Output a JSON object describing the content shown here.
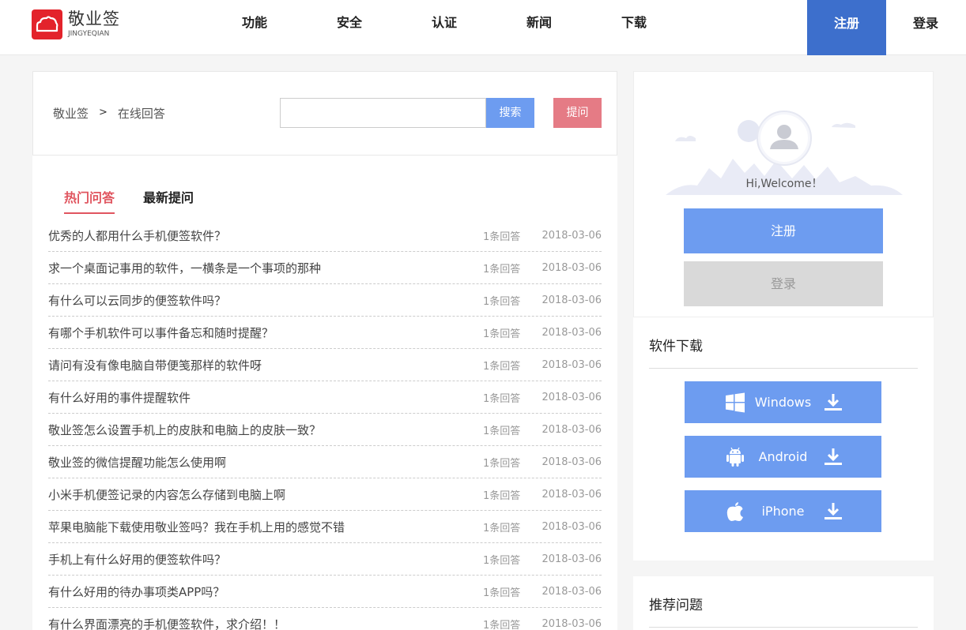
{
  "header": {
    "logo_cn": "敬业签",
    "logo_en": "JINGYEQIAN",
    "nav": [
      "功能",
      "安全",
      "认证",
      "新闻",
      "下载"
    ],
    "register": "注册",
    "login": "登录"
  },
  "search": {
    "breadcrumb_home": "敬业签",
    "breadcrumb_sep": ">",
    "breadcrumb_current": "在线回答",
    "input_value": "",
    "search_btn": "搜索",
    "ask_btn": "提问"
  },
  "tabs": [
    {
      "label": "热门问答",
      "active": true
    },
    {
      "label": "最新提问",
      "active": false
    }
  ],
  "questions": [
    {
      "title": "优秀的人都用什么手机便签软件？",
      "count": "1条回答",
      "date": "2018-03-06"
    },
    {
      "title": "求一个桌面记事用的软件，一横条是一个事项的那种",
      "count": "1条回答",
      "date": "2018-03-06"
    },
    {
      "title": "有什么可以云同步的便签软件吗？",
      "count": "1条回答",
      "date": "2018-03-06"
    },
    {
      "title": "有哪个手机软件可以事件备忘和随时提醒？",
      "count": "1条回答",
      "date": "2018-03-06"
    },
    {
      "title": "请问有没有像电脑自带便笺那样的软件呀",
      "count": "1条回答",
      "date": "2018-03-06"
    },
    {
      "title": "有什么好用的事件提醒软件",
      "count": "1条回答",
      "date": "2018-03-06"
    },
    {
      "title": "敬业签怎么设置手机上的皮肤和电脑上的皮肤一致？",
      "count": "1条回答",
      "date": "2018-03-06"
    },
    {
      "title": "敬业签的微信提醒功能怎么使用啊",
      "count": "1条回答",
      "date": "2018-03-06"
    },
    {
      "title": "小米手机便签记录的内容怎么存储到电脑上啊",
      "count": "1条回答",
      "date": "2018-03-06"
    },
    {
      "title": "苹果电脑能下载使用敬业签吗？我在手机上用的感觉不错",
      "count": "1条回答",
      "date": "2018-03-06"
    },
    {
      "title": "手机上有什么好用的便签软件吗？",
      "count": "1条回答",
      "date": "2018-03-06"
    },
    {
      "title": "有什么好用的待办事项类APP吗？",
      "count": "1条回答",
      "date": "2018-03-06"
    },
    {
      "title": "有什么界面漂亮的手机便签软件，求介绍！！",
      "count": "1条回答",
      "date": "2018-03-06"
    }
  ],
  "welcome": {
    "text": "Hi,Welcome！",
    "register": "注册",
    "login": "登录"
  },
  "downloads": {
    "title": "软件下载",
    "items": [
      {
        "label": "Windows",
        "icon": "windows-icon"
      },
      {
        "label": "Android",
        "icon": "android-icon"
      },
      {
        "label": "iPhone",
        "icon": "apple-icon"
      }
    ]
  },
  "recommend": {
    "title": "推荐问题"
  },
  "colors": {
    "primary": "#3d6fcc",
    "button_blue": "#6d9cf0",
    "ask_red": "#e57b85",
    "active_tab": "#e0555f",
    "logo_red": "#e3232b"
  }
}
